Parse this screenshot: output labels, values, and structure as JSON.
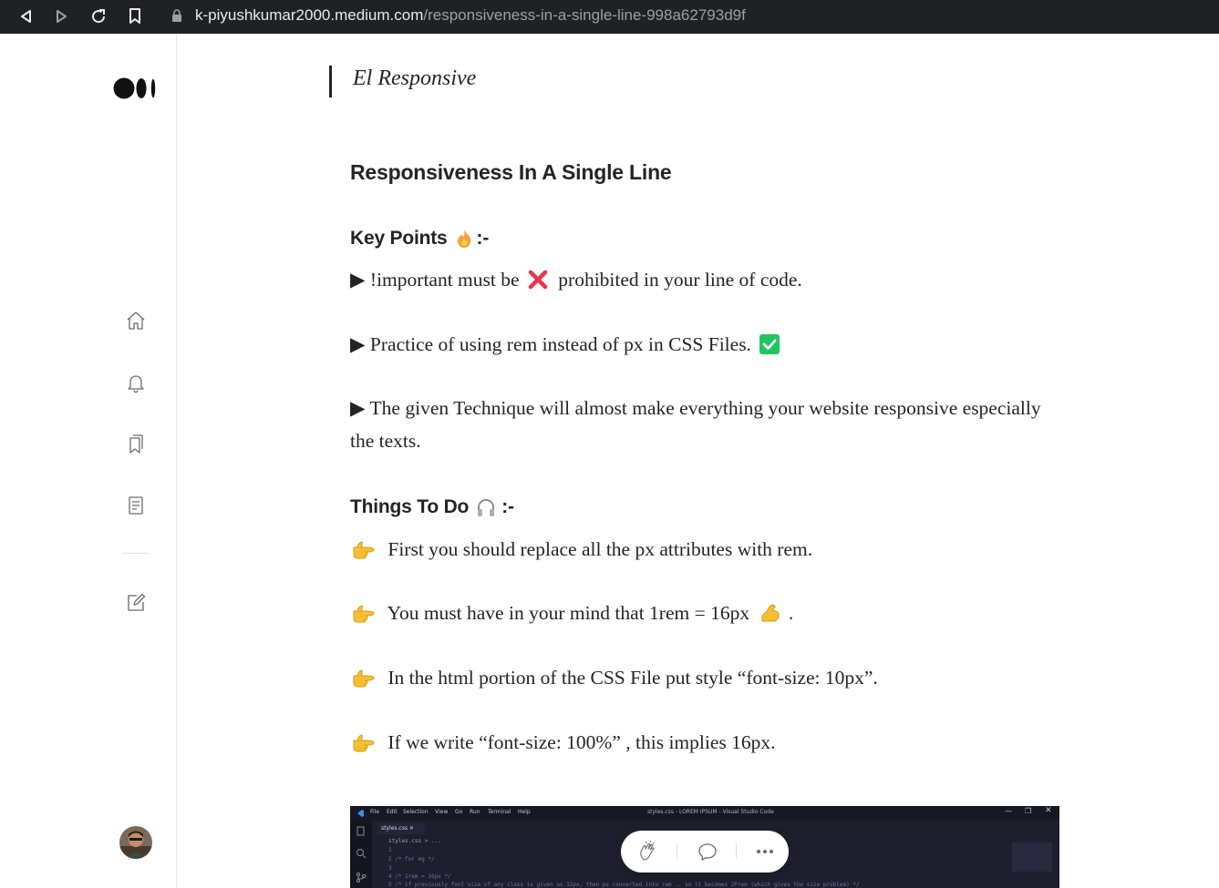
{
  "browser": {
    "url_host": "k-piyushkumar2000.medium.com",
    "url_path": "/responsiveness-in-a-single-line-998a62793d9f"
  },
  "sidebar": {
    "items": [
      {
        "name": "home",
        "icon": "home-icon"
      },
      {
        "name": "notifications",
        "icon": "bell-icon"
      },
      {
        "name": "lists",
        "icon": "bookmarks-icon"
      },
      {
        "name": "stories",
        "icon": "document-icon"
      },
      {
        "name": "write",
        "icon": "edit-icon"
      }
    ]
  },
  "article": {
    "publication": "El Responsive",
    "title": "Responsiveness In A Single Line",
    "key_points": {
      "heading": "Key Points",
      "heading_suffix": ":-",
      "items": [
        {
          "marker": "▶",
          "before": "!important must be",
          "after": "prohibited in your line of code."
        },
        {
          "marker": "▶",
          "text": "Practice of using rem instead of px in CSS Files."
        },
        {
          "marker": "▶",
          "text": "The given Technique will almost make everything your website responsive especially the texts."
        }
      ]
    },
    "things_to_do": {
      "heading": "Things To Do",
      "heading_suffix": ":-",
      "items": [
        {
          "text": "First you should replace all the px attributes with rem."
        },
        {
          "before": "You must have in your mind that 1rem = 16px",
          "after": "."
        },
        {
          "text": "In the html portion of the CSS File put style “font-size: 10px”."
        },
        {
          "text": "If we write “font-size: 100%” , this implies 16px."
        }
      ]
    }
  },
  "embedded_image": {
    "menu": [
      "File",
      "Edit",
      "Selection",
      "View",
      "Go",
      "Run",
      "Terminal",
      "Help"
    ],
    "window_title": "styles.css - LOREM IPSUM - Visual Studio Code",
    "tab": "styles.css",
    "breadcrumb": "styles.css > ...",
    "code_lines": [
      "1",
      "2    /* for eg */",
      "3",
      "4    /* 1rem = 16px */",
      "5    /* if previously font size of any class is given as 32px, then px converted into rem .. so it becomes 2Prem (which gives the size problem) */"
    ]
  },
  "colors": {
    "text": "#242424",
    "browser_bar": "#202124",
    "check_green": "#21c55d",
    "cross_red": "#e8344e",
    "emoji_yellow": "#f7c034"
  }
}
